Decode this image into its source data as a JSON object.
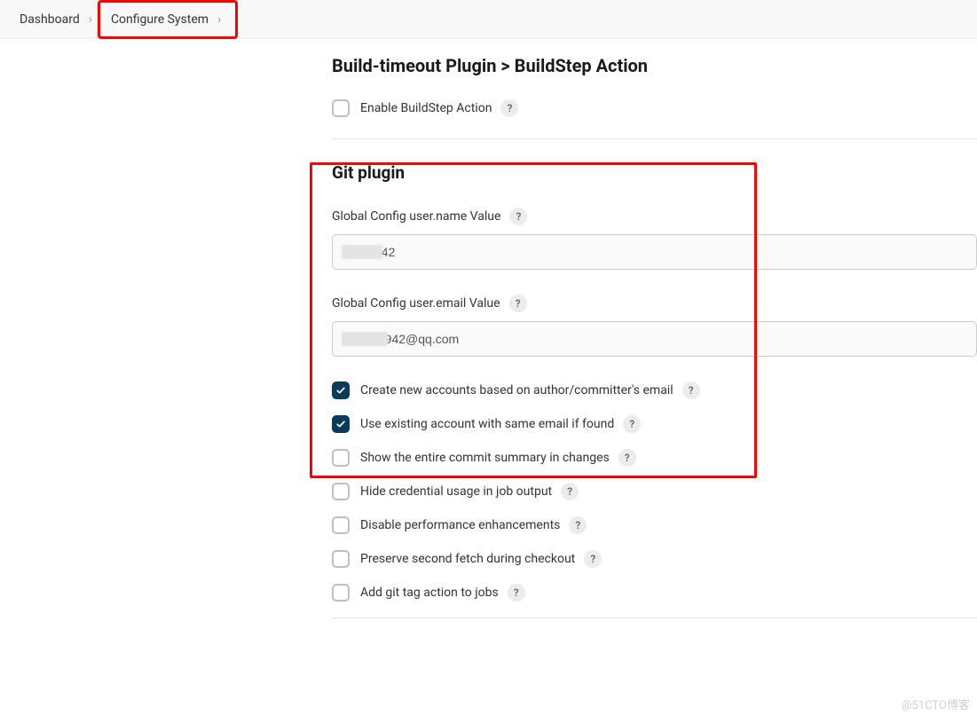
{
  "breadcrumb": {
    "dashboard": "Dashboard",
    "configure": "Configure System"
  },
  "section1": {
    "title": "Build-timeout Plugin > BuildStep Action",
    "enable_label": "Enable BuildStep Action"
  },
  "git": {
    "title": "Git plugin",
    "username_label": "Global Config user.name Value",
    "username_value": "         942",
    "email_label": "Global Config user.email Value",
    "email_value": "            942@qq.com",
    "opts": {
      "create_accounts": "Create new accounts based on author/committer's email",
      "use_existing": "Use existing account with same email if found",
      "show_summary": "Show the entire commit summary in changes",
      "hide_cred": "Hide credential usage in job output",
      "disable_perf": "Disable performance enhancements",
      "preserve_fetch": "Preserve second fetch during checkout",
      "add_tag": "Add git tag action to jobs"
    }
  },
  "watermark": "@51CTO博客",
  "help_glyph": "?"
}
